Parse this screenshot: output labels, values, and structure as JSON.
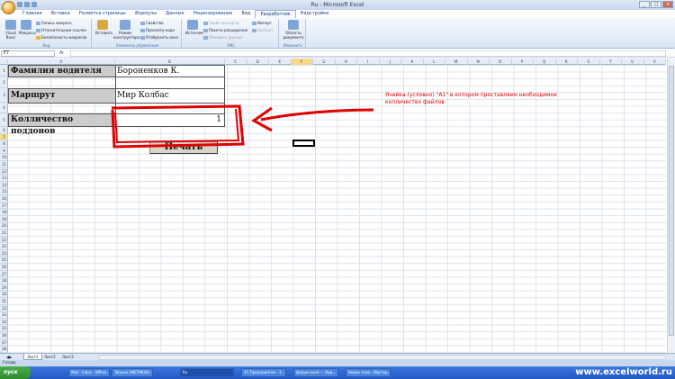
{
  "window": {
    "title": "Ru - Microsoft Excel",
    "minimize": "_",
    "maximize": "□",
    "close": "×"
  },
  "tabs": [
    "Главная",
    "Вставка",
    "Разметка страницы",
    "Формулы",
    "Данные",
    "Рецензирование",
    "Вид",
    "Разработчик",
    "Надстройки"
  ],
  "active_tab": "Разработчик",
  "ribbon": {
    "code_group": "Код",
    "controls_group": "Элементы управления",
    "xml_group": "XML",
    "change_group": "Изменить",
    "visual_basic": "Visual Basic",
    "macros": "Макросы",
    "record_macro": "Запись макроса",
    "relative_refs": "Относительные ссылки",
    "macro_security": "Безопасность макросов",
    "insert": "Вставить",
    "design_mode": "Режим конструктора",
    "properties": "Свойства",
    "view_code": "Просмотр кода",
    "run_dialog": "Отобразить окно",
    "source": "Источник",
    "map_properties": "Свойства карты",
    "expansion_packs": "Пакеты расширения",
    "refresh_data": "Обновить данные",
    "import": "Импорт",
    "export": "Экспорт",
    "doc_panel": "Область документа"
  },
  "formula_bar": {
    "name_box": "F7",
    "fx": "fx",
    "formula": ""
  },
  "columns": [
    "A",
    "B",
    "C",
    "D",
    "E",
    "F",
    "G",
    "H",
    "I",
    "J",
    "K",
    "L",
    "M",
    "N",
    "O",
    "P",
    "Q",
    "R",
    "S",
    "T",
    "U",
    "V"
  ],
  "rows": [
    "1",
    "2",
    "3",
    "4",
    "5",
    "6",
    "7",
    "8",
    "9",
    "10",
    "11",
    "12",
    "13",
    "14",
    "15",
    "16",
    "17",
    "18",
    "19",
    "20",
    "21",
    "22",
    "23",
    "24",
    "25",
    "26",
    "27",
    "28",
    "29",
    "30",
    "31",
    "32",
    "33",
    "34",
    "35",
    "36",
    "37",
    "38",
    "39",
    "40",
    "41",
    "42"
  ],
  "selected_column": "F",
  "selected_row": "7",
  "form": {
    "driver_label": "Фамилия водителя",
    "driver_value": "Бороненков К.",
    "route_label": "Маршрут",
    "route_value": "Мир Колбас",
    "pallets_label": "Колличество поддонов",
    "pallets_value": "1",
    "print_button": "Печать"
  },
  "annotation": "Ячейка (условно) \"А1\" в котором проставляем необходимое колличество файлов",
  "sheets": [
    "Лист1",
    "Лист2",
    "Лист3"
  ],
  "active_sheet": "Лист1",
  "status": "Готово",
  "taskbar": {
    "start": "пуск",
    "items": [
      "Mail - Inbox - IBProt...",
      "Tatyana [МЕТИКОН...",
      "Ru",
      "1С:Предприятие - З...",
      "форум excel — Янд...",
      "Новая тема - Мастер..."
    ],
    "watermark": "www.excelworld.ru"
  },
  "colors": {
    "annotation": "#e00000",
    "label_fill": "#cccccc",
    "taskbar": "#2356c5"
  }
}
